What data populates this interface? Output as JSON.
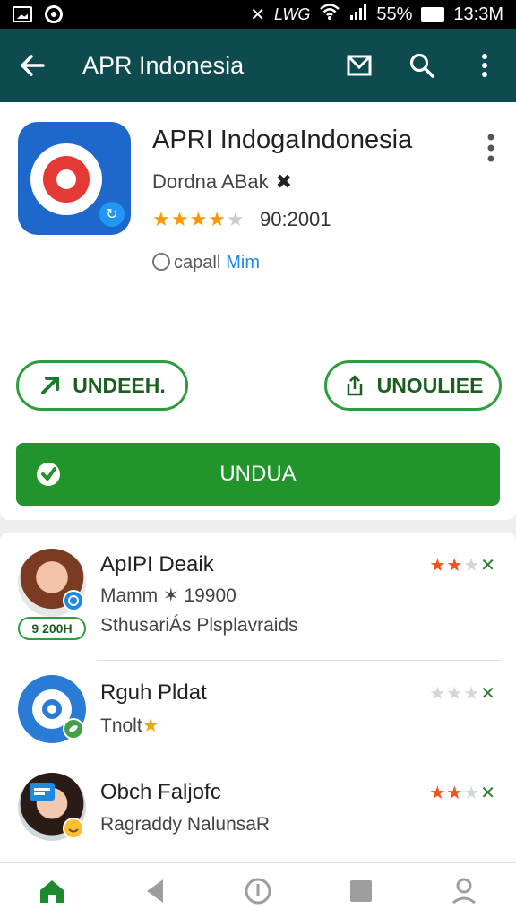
{
  "status_bar": {
    "battery_pct": "55%",
    "time": "13:3M",
    "network_label": "LWG"
  },
  "appbar": {
    "title": "APR Indonesia"
  },
  "app": {
    "name": "APRI IndogaIndonesia",
    "developer": "Dordna ABak",
    "rating_stars": 4,
    "rating_value": "90:2001",
    "chip_label": "capall",
    "chip_link": "Mim",
    "btn_left": "UNDEEH.",
    "btn_right": "UNOULIEE",
    "install_label": "UNDUA"
  },
  "list": [
    {
      "title": "ApIPI Deaik",
      "sub": "Mamm ✶ 19900",
      "sub2": "SthusariÁs Plsplavraids",
      "pill": "9 200H",
      "stars_on": 2
    },
    {
      "title": "Rguh Pldat",
      "sub": "Tnolt",
      "stars_on": 0
    },
    {
      "title": "Obch Faljofc",
      "sub": "Ragraddy NalunsaR",
      "stars_on": 2
    }
  ],
  "colors": {
    "appbar": "#0d4b4f",
    "install": "#21952c",
    "accent_green": "#2e9d3b",
    "star": "#ff9800"
  }
}
